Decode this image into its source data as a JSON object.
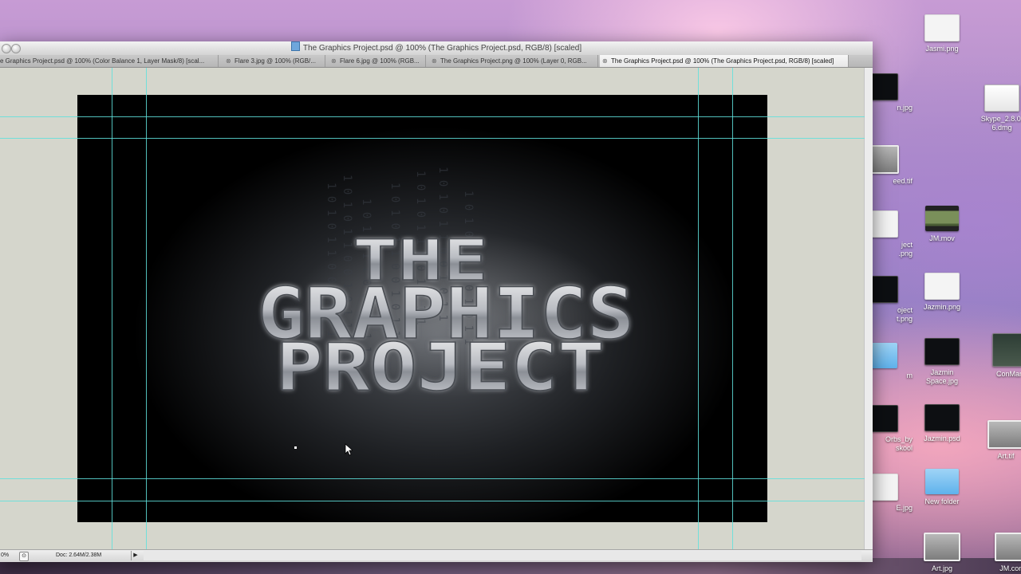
{
  "window": {
    "title": "The Graphics Project.psd @ 100% (The Graphics Project.psd, RGB/8) [scaled]"
  },
  "tabs": [
    {
      "label": "e Graphics Project.psd @ 100% (Color Balance 1, Layer Mask/8) [scal...",
      "active": false
    },
    {
      "label": "Flare 3.jpg @ 100% (RGB/...",
      "active": false
    },
    {
      "label": "Flare 6.jpg @ 100% (RGB...",
      "active": false
    },
    {
      "label": "The Graphics Project.png @ 100% (Layer 0, RGB...",
      "active": false
    },
    {
      "label": "The Graphics Project.psd @ 100% (The Graphics Project.psd, RGB/8) [scaled]",
      "active": true
    }
  ],
  "artwork": {
    "lines": [
      "THE",
      "GRAPHICS",
      "PROJECT"
    ],
    "binary_text": "1 0 1 0 1 1 0 0 1 0 1 1"
  },
  "status": {
    "zoom": "0%",
    "doc_size": "Doc: 2.64M/2.38M"
  },
  "desktop_icons": [
    {
      "label": "Jasmi.png",
      "kind": "white"
    },
    {
      "label": "Skype_2.8.0.\n6.dmg",
      "kind": "doc"
    },
    {
      "label": "JM.mov",
      "kind": "film"
    },
    {
      "label": "Jazmin.png",
      "kind": "white"
    },
    {
      "label": "Jazmin\nSpace.jpg",
      "kind": "dark"
    },
    {
      "label": "ConMan",
      "kind": "green"
    },
    {
      "label": "Jazmin.psd",
      "kind": "dark"
    },
    {
      "label": "Art.tif",
      "kind": "gray"
    },
    {
      "label": "New folder",
      "kind": "folder"
    },
    {
      "label": "Art.jpg",
      "kind": "gray"
    },
    {
      "label": "JM.conv",
      "kind": "gray"
    }
  ],
  "partial_icons": [
    {
      "label": "n.jpg"
    },
    {
      "label": "eed.tif"
    },
    {
      "label": "ject\n.png"
    },
    {
      "label": "oject\nt.png"
    },
    {
      "label": "m"
    },
    {
      "label": "Orbs_by\nskool"
    },
    {
      "label": "E.jpg"
    }
  ],
  "colors": {
    "guide": "#5fe0dc",
    "workspace": "#d5d6cc"
  }
}
